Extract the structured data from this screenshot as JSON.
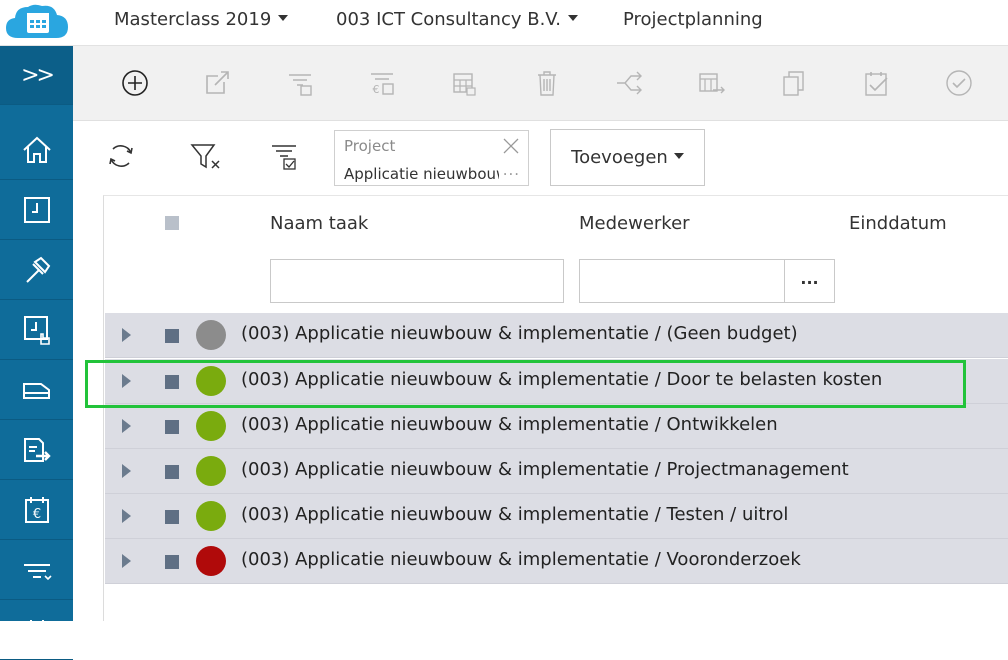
{
  "topbar": {
    "environment": "Masterclass 2019",
    "company": "003 ICT Consultancy B.V.",
    "module": "Projectplanning"
  },
  "sidebar": {
    "expand_label": ">>",
    "items": [
      {
        "icon": "home-icon"
      },
      {
        "icon": "timesheet-icon"
      },
      {
        "icon": "hammer-icon"
      },
      {
        "icon": "timesheet-approve-icon"
      },
      {
        "icon": "truck-icon"
      },
      {
        "icon": "invoice-export-icon"
      },
      {
        "icon": "calendar-euro-icon"
      },
      {
        "icon": "filter-lines-icon"
      },
      {
        "icon": "calendar-icon"
      }
    ]
  },
  "toolbar": {
    "icons": [
      "add-icon",
      "open-external-icon",
      "filter-edit-icon",
      "cost-filter-icon",
      "calendar-grid-icon",
      "delete-icon",
      "split-icon",
      "calendar-forward-icon",
      "copy-icon",
      "clipboard-check-icon",
      "check-circle-icon"
    ]
  },
  "filters": {
    "icons": [
      "refresh-icon",
      "clear-filter-icon",
      "filter-settings-icon"
    ],
    "project_chip": {
      "label": "Project",
      "value": "Applicatie nieuwbouw & implementatie",
      "more": "..."
    },
    "add_button": "Toevoegen"
  },
  "grid": {
    "columns": {
      "name": "Naam taak",
      "employee": "Medewerker",
      "enddate": "Einddatum"
    },
    "dots_button": "...",
    "rows": [
      {
        "label": "(003) Applicatie nieuwbouw & implementatie / (Geen budget)",
        "status_color": "#8c8c8c"
      },
      {
        "label": "(003) Applicatie nieuwbouw & implementatie / Door te belasten kosten",
        "status_color": "#7aab0e"
      },
      {
        "label": "(003) Applicatie nieuwbouw & implementatie / Ontwikkelen",
        "status_color": "#7aab0e"
      },
      {
        "label": "(003) Applicatie nieuwbouw & implementatie / Projectmanagement",
        "status_color": "#7aab0e"
      },
      {
        "label": "(003) Applicatie nieuwbouw & implementatie / Testen / uitrol",
        "status_color": "#7aab0e"
      },
      {
        "label": "(003) Applicatie nieuwbouw & implementatie / Vooronderzoek",
        "status_color": "#b00a0a"
      }
    ]
  },
  "colors": {
    "brand": "#0f6c9a",
    "highlight": "#22c33a"
  }
}
